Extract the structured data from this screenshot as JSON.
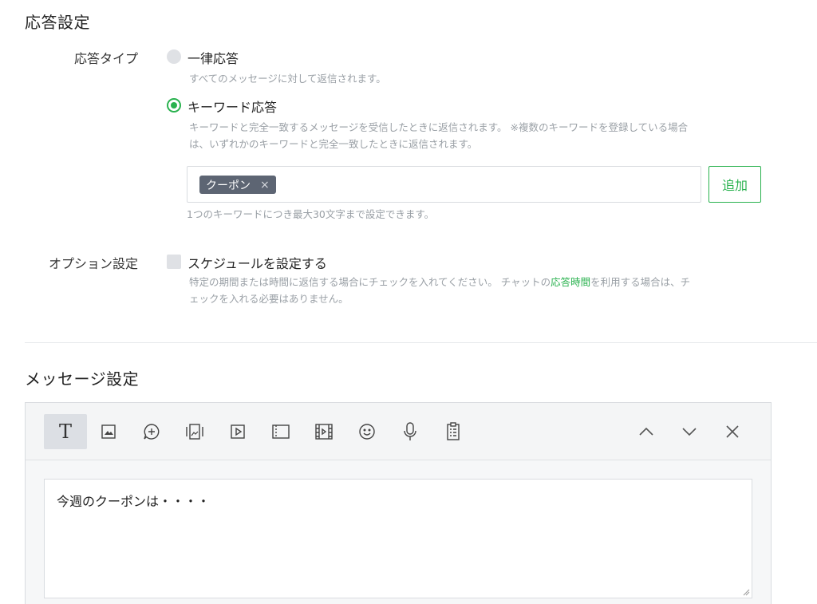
{
  "response_settings": {
    "title": "応答設定",
    "type_label": "応答タイプ",
    "options": [
      {
        "label": "一律応答",
        "hint": "すべてのメッセージに対して返信されます。",
        "selected": false
      },
      {
        "label": "キーワード応答",
        "hint_line1": "キーワードと完全一致するメッセージを受信したときに返信されます。 ※複数のキーワードを登録している場合",
        "hint_line2": "は、いずれかのキーワードと完全一致したときに返信されます。",
        "selected": true
      }
    ],
    "keywords": [
      "クーポン"
    ],
    "chip_remove": "×",
    "add_button": "追加",
    "keyword_hint": "1つのキーワードにつき最大30文字まで設定できます。",
    "option_label": "オプション設定",
    "schedule_checkbox": {
      "label": "スケジュールを設定する",
      "checked": false,
      "hint_part1": "特定の期間または時間に返信する場合にチェックを入れてください。 チャットの",
      "hint_link": "応答時間",
      "hint_part2": "を利用する場合は、チ",
      "hint_line2": "ェックを入れる必要はありません。"
    }
  },
  "message_settings": {
    "title": "メッセージ設定",
    "toolbar": {
      "text_tool": "T",
      "icons": [
        "text-icon",
        "image-icon",
        "chat-plus-icon",
        "image-carousel-icon",
        "video-icon",
        "card-icon",
        "film-icon",
        "emoji-icon",
        "microphone-icon",
        "clipboard-icon",
        "chevron-up-icon",
        "chevron-down-icon",
        "close-icon"
      ]
    },
    "message_text": "今週のクーポンは・・・・"
  },
  "colors": {
    "accent_green": "#2ab24f",
    "chip_bg": "#5d6573",
    "hint_gray": "#9aa0a6"
  }
}
